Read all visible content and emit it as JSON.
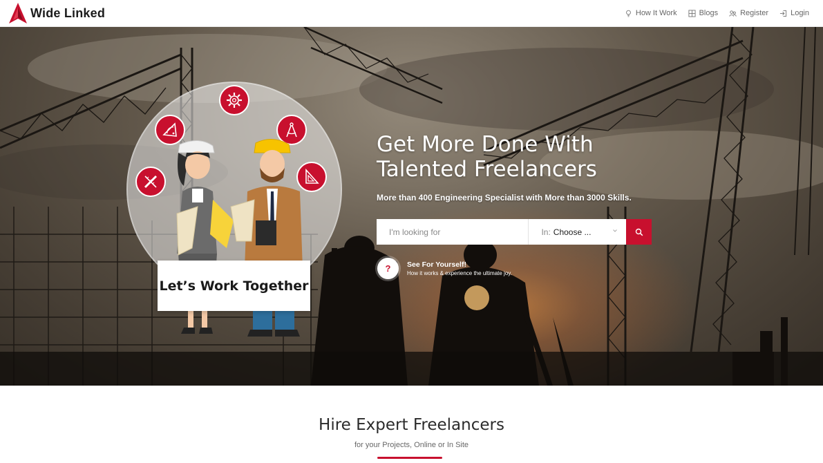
{
  "brand": {
    "name": "Wide Linked",
    "accent": "#c8102e"
  },
  "nav": {
    "items": [
      {
        "label": "How It Work",
        "icon": "lightbulb-icon"
      },
      {
        "label": "Blogs",
        "icon": "grid-icon"
      },
      {
        "label": "Register",
        "icon": "users-icon"
      },
      {
        "label": "Login",
        "icon": "login-icon"
      }
    ]
  },
  "hero": {
    "headline_line1": "Get More Done With",
    "headline_line2": "Talented Freelancers",
    "subline": "More than 400 Engineering Specialist with More than 3000 Skills.",
    "illustration_caption": "Let’s Work Together",
    "badge_icons": [
      "protractor-icon",
      "gear-icon",
      "compass-icon",
      "pencil-ruler-icon",
      "set-square-icon"
    ],
    "search": {
      "placeholder": "I'm looking for",
      "category_prefix": "In:",
      "category_value": "Choose ...",
      "button_icon": "search-icon"
    },
    "see_yourself": {
      "icon_glyph": "?",
      "title": "See For Yourself!",
      "subtitle": "How it works & experience the ultimate joy."
    }
  },
  "section": {
    "title": "Hire Expert Freelancers",
    "subtitle": "for your Projects, Online or In Site"
  }
}
